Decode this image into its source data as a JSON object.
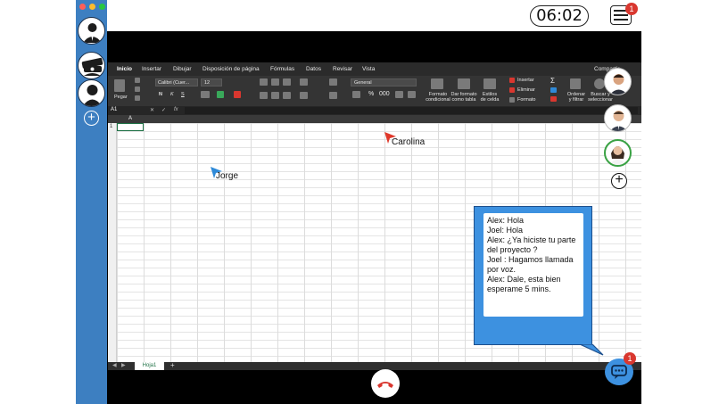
{
  "clock": {
    "time": "06:02"
  },
  "notifications": {
    "menu_badge": "1",
    "chat_badge": "1"
  },
  "excel": {
    "tabs": [
      "Inicio",
      "Insertar",
      "Dibujar",
      "Disposición de página",
      "Fórmulas",
      "Datos",
      "Revisar",
      "Vista"
    ],
    "share_label": "Compartir",
    "paste_label": "Pegar",
    "font_name": "Calibri (Cuer...",
    "font_size": "12",
    "number_format": "General",
    "conditional_format": [
      "Formato",
      "condicional"
    ],
    "table_format": [
      "Dar formato",
      "como tabla"
    ],
    "cell_styles": [
      "Estilos",
      "de celda"
    ],
    "insert_label": "Insertar",
    "delete_label": "Eliminar",
    "format_label": "Formato",
    "sort_label": [
      "Ordenar",
      "y filtrar"
    ],
    "find_label": [
      "Buscar y",
      "seleccionar"
    ],
    "name_box": "A1",
    "fx_label": "fx",
    "col_a": "A",
    "row_1": "1",
    "sheet_tab": "Hoja1"
  },
  "cursors": {
    "carolina": {
      "name": "Carolina",
      "color": "#e0392b"
    },
    "jorge": {
      "name": "Jorge",
      "color": "#2f8ad8"
    }
  },
  "chat": {
    "messages": [
      "Alex: Hola",
      "Joel: Hola",
      "Alex: ¿Ya hiciste tu parte del proyecto ?",
      "Joel : Hagamos llamada por voz.",
      "Alex: Dale, esta bien esperame 5 mins."
    ]
  },
  "colors": {
    "sidebar": "#3d7fc1",
    "chat_bubble": "#3d91e0",
    "end_call": "#d9372f",
    "badge": "#d9372f",
    "active_ring": "#3aa244"
  }
}
